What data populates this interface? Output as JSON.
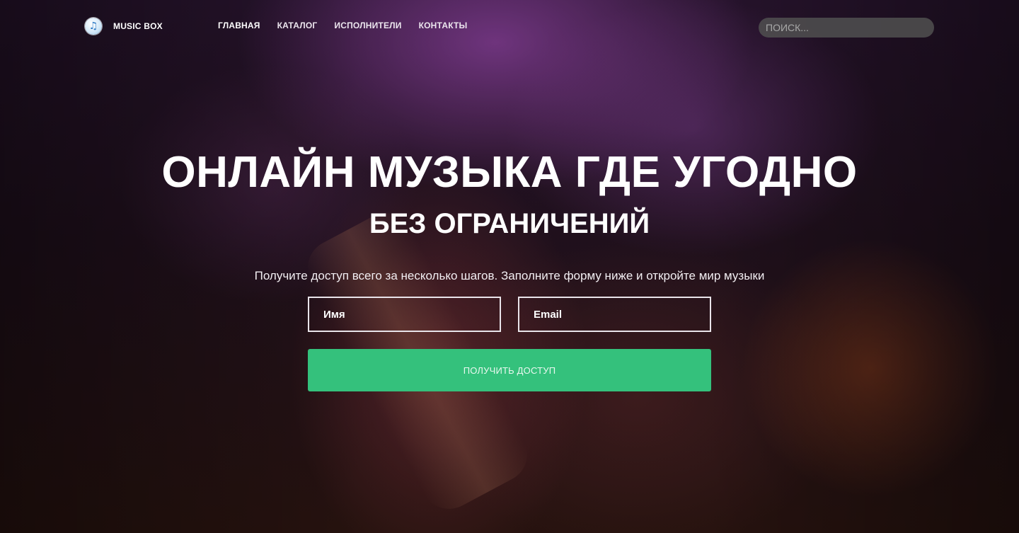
{
  "header": {
    "logo_icon": "music-note-icon",
    "brand": "MUSIC BOX",
    "nav": [
      {
        "label": "ГЛАВНАЯ"
      },
      {
        "label": "КАТАЛОГ"
      },
      {
        "label": "ИСПОЛНИТЕЛИ"
      },
      {
        "label": "КОНТАКТЫ"
      }
    ],
    "search_placeholder": "ПОИСК..."
  },
  "hero": {
    "title": "ОНЛАЙН МУЗЫКА ГДЕ УГОДНО",
    "subtitle": "БЕЗ ОГРАНИЧЕНИЙ",
    "description": "Получите доступ всего за несколько шагов. Заполните форму ниже и откройте мир музыки",
    "form": {
      "name_placeholder": "Имя",
      "email_placeholder": "Email",
      "submit_label": "ПОЛУЧИТЬ ДОСТУП"
    }
  },
  "colors": {
    "accent": "#34c17c",
    "search_bg": "#505050"
  }
}
